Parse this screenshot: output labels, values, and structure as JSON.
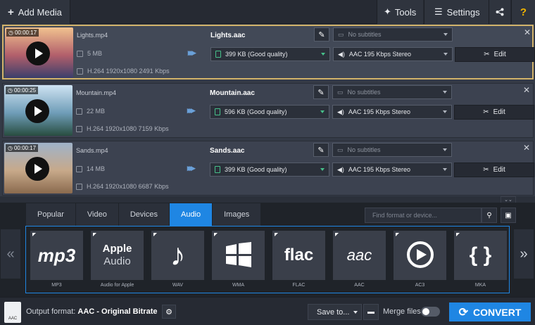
{
  "toolbar": {
    "add_media": "Add Media",
    "tools": "Tools",
    "settings": "Settings",
    "share_icon": "share-icon",
    "help": "?"
  },
  "files": [
    {
      "duration": "00:00:17",
      "name": "Lights.mp4",
      "size": "5 MB",
      "codec": "H.264 1920x1080 2491 Kbps",
      "output_name": "Lights.aac",
      "quality": "399 KB (Good quality)",
      "subtitles": "No subtitles",
      "audio": "AAC 195 Kbps Stereo",
      "edit": "Edit",
      "colors": [
        "#f1c28f",
        "#b25f6b",
        "#3a3f6b"
      ]
    },
    {
      "duration": "00:00:25",
      "name": "Mountain.mp4",
      "size": "22 MB",
      "codec": "H.264 1920x1080 7159 Kbps",
      "output_name": "Mountain.aac",
      "quality": "596 KB (Good quality)",
      "subtitles": "No subtitles",
      "audio": "AAC 195 Kbps Stereo",
      "edit": "Edit",
      "colors": [
        "#cfe3f2",
        "#6f9db8",
        "#284d40"
      ]
    },
    {
      "duration": "00:00:17",
      "name": "Sands.mp4",
      "size": "14 MB",
      "codec": "H.264 1920x1080 6687 Kbps",
      "output_name": "Sands.aac",
      "quality": "399 KB (Good quality)",
      "subtitles": "No subtitles",
      "audio": "AAC 195 Kbps Stereo",
      "edit": "Edit",
      "colors": [
        "#9fb3c9",
        "#c7a98a",
        "#8a6a4e"
      ]
    }
  ],
  "tabs": [
    "Popular",
    "Video",
    "Devices",
    "Audio",
    "Images"
  ],
  "active_tab": "Audio",
  "search": {
    "placeholder": "Find format or device..."
  },
  "formats": [
    {
      "label": "MP3",
      "icon": "mp3"
    },
    {
      "label": "Audio for Apple",
      "icon": "Apple Audio"
    },
    {
      "label": "WAV",
      "icon": "♪"
    },
    {
      "label": "WMA",
      "icon": "windows"
    },
    {
      "label": "FLAC",
      "icon": "flac"
    },
    {
      "label": "AAC",
      "icon": "aac"
    },
    {
      "label": "AC3",
      "icon": "ac3"
    },
    {
      "label": "MKA",
      "icon": "{ }"
    }
  ],
  "footer": {
    "output_prefix": "Output format:",
    "output_format": "AAC",
    "output_sep": "-",
    "output_bitrate": "Original Bitrate",
    "icon_label": "AAC",
    "save_to": "Save to...",
    "merge_files": "Merge files:",
    "convert": "CONVERT"
  },
  "colors": {
    "accent": "#1f86e3",
    "selected_border": "#d2b36a",
    "quality_icon": "#46c08a",
    "help": "#f0b400"
  }
}
